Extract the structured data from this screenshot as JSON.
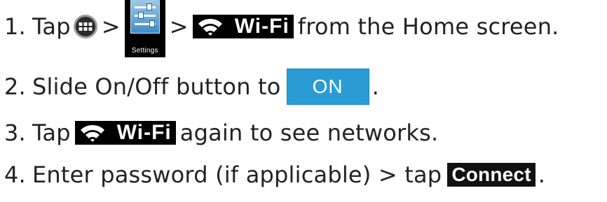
{
  "steps": [
    {
      "number": "1.",
      "word_tap": "Tap",
      "sep1": ">",
      "sep2": ">",
      "settings_label": "Settings",
      "wifi_label": "Wi-Fi",
      "tail": "from the Home screen."
    },
    {
      "number": "2.",
      "lead": "Slide On/Off button to",
      "toggle_label": "ON",
      "tail": "."
    },
    {
      "number": "3.",
      "word_tap": "Tap",
      "wifi_label": "Wi-Fi",
      "tail": "again to see networks."
    },
    {
      "number": "4.",
      "lead": "Enter password (if applicable) > tap",
      "connect_label": "Connect",
      "tail": "."
    }
  ],
  "icons": {
    "apps": "apps-grid-icon",
    "settings": "settings-sliders-icon",
    "wifi": "wifi-icon"
  },
  "colors": {
    "text": "#222222",
    "toggle_on": "#2b9bd6",
    "chip_background": "#000000"
  }
}
